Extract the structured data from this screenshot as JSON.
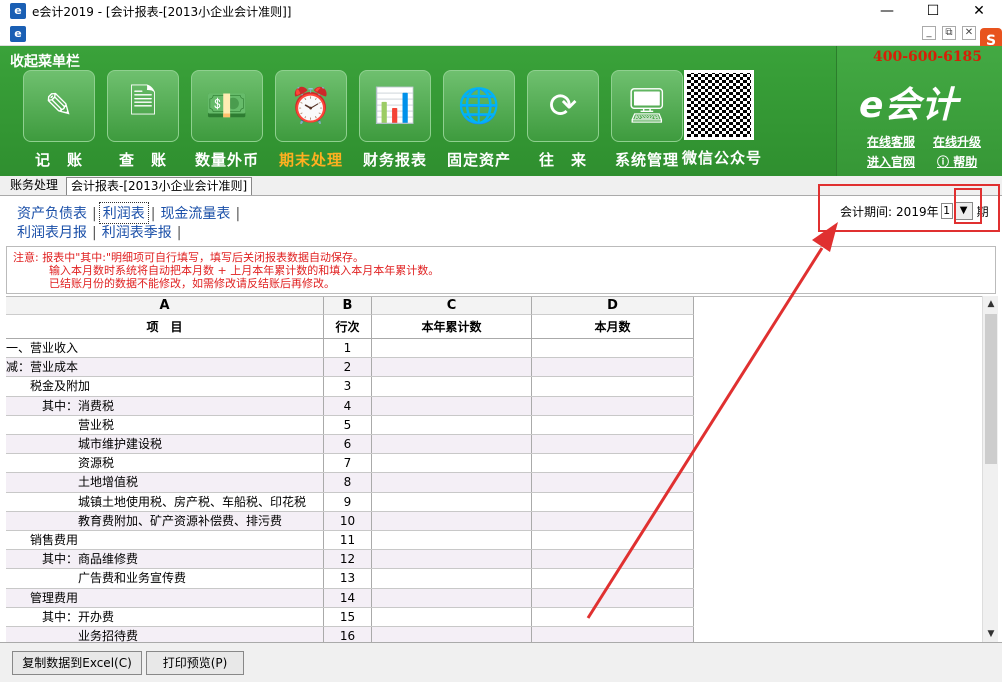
{
  "window": {
    "title": "e会计2019 - [会计报表-[2013小企业会计准则]]",
    "controls": [
      "—",
      "☐",
      "✕"
    ]
  },
  "toolbar": {
    "collapse_label": "收起菜单栏",
    "items": [
      {
        "label": "记　账",
        "icon": "ledger-pen-icon",
        "glyph": "✎"
      },
      {
        "label": "查　账",
        "icon": "document-chart-icon",
        "glyph": "🗎"
      },
      {
        "label": "数量外币",
        "icon": "currency-notes-icon",
        "glyph": "💵"
      },
      {
        "label": "期末处理",
        "icon": "clock-coins-icon",
        "glyph": "⏰",
        "active": true
      },
      {
        "label": "财务报表",
        "icon": "bar-chart-icon",
        "glyph": "📊"
      },
      {
        "label": "固定资产",
        "icon": "globe-coins-icon",
        "glyph": "🌐"
      },
      {
        "label": "往　来",
        "icon": "cycle-arrows-icon",
        "glyph": "⟳"
      },
      {
        "label": "系统管理",
        "icon": "monitor-icon",
        "glyph": "🖥"
      },
      {
        "label": "微信公众号",
        "icon": "qr-code-icon",
        "glyph": ""
      }
    ],
    "active_color": "#ffb020"
  },
  "brand": {
    "phone": "400-600-6185",
    "logo": "e会计",
    "links": {
      "online_service": "在线客服",
      "online_upgrade": "在线升级",
      "enter_website": "进入官网",
      "help": "帮助"
    }
  },
  "doc_tabs": {
    "inactive": "账务处理",
    "active": "会计报表-[2013小企业会计准则]"
  },
  "report_tabs": {
    "row1": [
      "资产负债表",
      "利润表",
      "现金流量表"
    ],
    "row2": [
      "利润表月报",
      "利润表季报"
    ],
    "selected": "利润表"
  },
  "period": {
    "label": "会计期间:",
    "year": "2019年",
    "value": "1",
    "suffix": "期"
  },
  "notice": {
    "line1": "注意: 报表中\"其中:\"明细项可自行填写，填写后关闭报表数据自动保存。",
    "line2": "输入本月数时系统将自动把本月数 + 上月本年累计数的和填入本月本年累计数。",
    "line3": "已结账月份的数据不能修改，如需修改请反结账后再修改。",
    "color": "#e02020"
  },
  "grid": {
    "col_letters": [
      "A",
      "B",
      "C",
      "D"
    ],
    "col_titles": [
      "项　目",
      "行次",
      "本年累计数",
      "本月数"
    ],
    "rows": [
      {
        "item": "一、营业收入",
        "line": "1",
        "lvl": 0
      },
      {
        "item": "减：营业成本",
        "line": "2",
        "lvl": 0
      },
      {
        "item": "税金及附加",
        "line": "3",
        "lvl": 1
      },
      {
        "item": "其中：消费税",
        "line": "4",
        "lvl": 2
      },
      {
        "item": "营业税",
        "line": "5",
        "lvl": 3
      },
      {
        "item": "城市维护建设税",
        "line": "6",
        "lvl": 3
      },
      {
        "item": "资源税",
        "line": "7",
        "lvl": 3
      },
      {
        "item": "土地增值税",
        "line": "8",
        "lvl": 3
      },
      {
        "item": "城镇土地使用税、房产税、车船税、印花税",
        "line": "9",
        "lvl": 3
      },
      {
        "item": "教育费附加、矿产资源补偿费、排污费",
        "line": "10",
        "lvl": 3
      },
      {
        "item": "销售费用",
        "line": "11",
        "lvl": 1
      },
      {
        "item": "其中：商品维修费",
        "line": "12",
        "lvl": 2
      },
      {
        "item": "广告费和业务宣传费",
        "line": "13",
        "lvl": 3
      },
      {
        "item": "管理费用",
        "line": "14",
        "lvl": 1
      },
      {
        "item": "其中：开办费",
        "line": "15",
        "lvl": 2
      },
      {
        "item": "业务招待费",
        "line": "16",
        "lvl": 3
      }
    ]
  },
  "buttons": {
    "copy_excel": "复制数据到Excel(C)",
    "print_preview": "打印预览(P)"
  },
  "annotation_color": "#e03030"
}
